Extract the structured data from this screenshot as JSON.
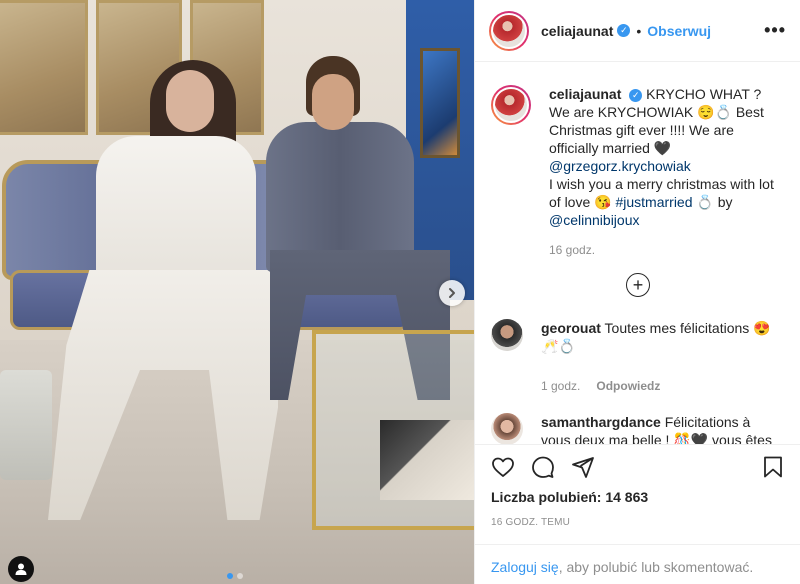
{
  "post": {
    "username": "celiajaunat",
    "follow_label": "Obserwuj",
    "separator": "•",
    "more_label": "•••"
  },
  "caption": {
    "username": "celiajaunat",
    "text_1": "KRYCHO WHAT ? We are KRYCHOWIAK 😌💍 Best Christmas gift ever !!!! We are officially married 🖤",
    "mention_1": "@grzegorz.krychowiak",
    "text_2": "I wish you a merry christmas with lot of love 😘",
    "hashtag": "#justmarried",
    "text_3": "💍 by",
    "mention_2": "@celinnibijoux",
    "time": "16 godz."
  },
  "comments": [
    {
      "username": "georouat",
      "text": "Toutes mes félicitations 😍🥂💍",
      "time": "1 godz.",
      "reply_label": "Odpowiedz"
    },
    {
      "username": "samanthargdance",
      "text": "Félicitations à vous deux ma belle ! 🎊🖤 vous êtes les plus beaux 😍"
    }
  ],
  "likes": {
    "label": "Liczba polubień:",
    "count": "14 863"
  },
  "timestamp": "16 GODZ. TEMU",
  "login_prompt": {
    "link": "Zaloguj się",
    "rest": ", aby polubić lub skomentować."
  },
  "icons": {
    "like": "heart-icon",
    "comment": "comment-icon",
    "share": "share-icon",
    "save": "bookmark-icon",
    "load_more": "plus-circle-icon",
    "carousel_next": "chevron-right-icon",
    "user_tag": "user-tag-icon"
  },
  "colors": {
    "accent": "#3897f0",
    "text": "#262626",
    "muted": "#8e8e8e",
    "link": "#00376b"
  },
  "carousel": {
    "total_slides": 2,
    "active_slide": 1
  }
}
